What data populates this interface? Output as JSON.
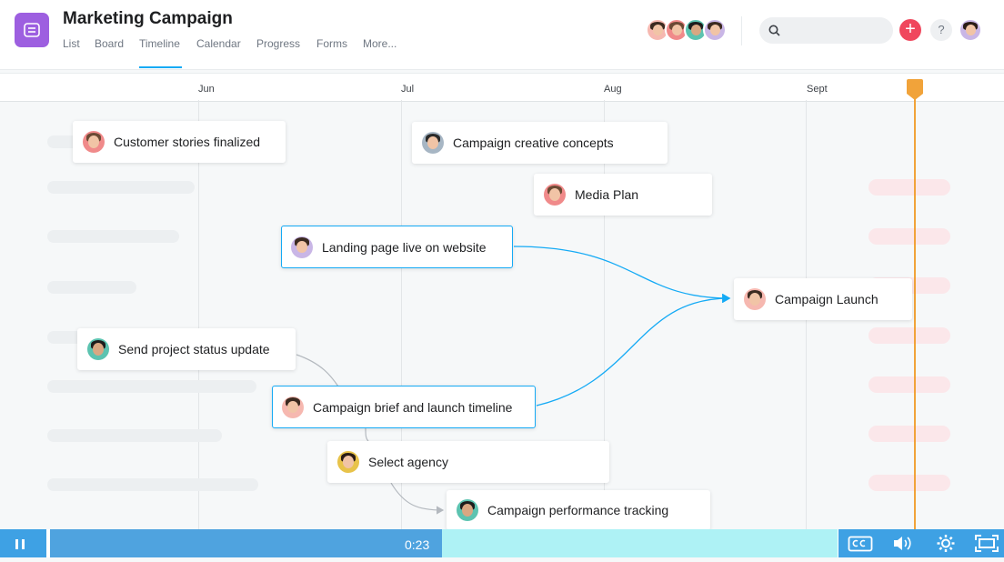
{
  "header": {
    "title": "Marketing Campaign",
    "tabs": [
      "List",
      "Board",
      "Timeline",
      "Calendar",
      "Progress",
      "Forms",
      "More..."
    ],
    "active_tab": "Timeline",
    "search_placeholder": "",
    "add_label": "+",
    "help_label": "?"
  },
  "timeline": {
    "months": [
      "Jun",
      "Jul",
      "Aug",
      "Sept"
    ],
    "tasks": [
      {
        "label": "Customer stories finalized",
        "selected": false
      },
      {
        "label": "Campaign creative concepts",
        "selected": false
      },
      {
        "label": "Media Plan",
        "selected": false
      },
      {
        "label": "Landing page live on website",
        "selected": true
      },
      {
        "label": "Campaign Launch",
        "selected": false
      },
      {
        "label": "Send project status update",
        "selected": false
      },
      {
        "label": "Campaign brief and launch timeline",
        "selected": true
      },
      {
        "label": "Select agency",
        "selected": false
      },
      {
        "label": "Campaign performance tracking",
        "selected": false
      }
    ]
  },
  "player": {
    "time": "0:23",
    "progress_fraction": 0.49,
    "icons": [
      "pause-icon",
      "closed-captions-icon",
      "volume-icon",
      "settings-icon",
      "fullscreen-icon"
    ]
  },
  "colors": {
    "accent": "#14aaf5",
    "today_marker": "#f1a33a",
    "app_icon": "#9d5fe0",
    "add_button": "#f0475d",
    "player": "#3ea1e4"
  }
}
